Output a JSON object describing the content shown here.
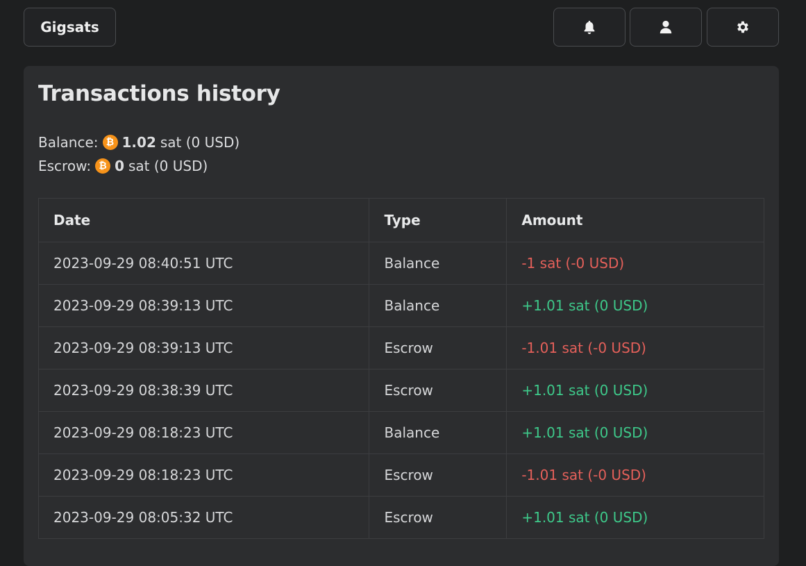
{
  "header": {
    "brand_label": "Gigsats",
    "icons": [
      "bell-icon",
      "user-icon",
      "gear-icon"
    ]
  },
  "page": {
    "title": "Transactions history",
    "balance": {
      "label": "Balance:",
      "value": "1.02",
      "unit": "sat (0 USD)"
    },
    "escrow": {
      "label": "Escrow:",
      "value": "0",
      "unit": "sat (0 USD)"
    },
    "btc_symbol": "₿"
  },
  "colors": {
    "negative": "#e5605a",
    "positive": "#3ec98a",
    "btc": "#f7931a"
  },
  "table": {
    "columns": [
      "Date",
      "Type",
      "Amount"
    ],
    "rows": [
      {
        "date": "2023-09-29 08:40:51 UTC",
        "type": "Balance",
        "amount": "-1 sat (-0 USD)",
        "sign": "neg"
      },
      {
        "date": "2023-09-29 08:39:13 UTC",
        "type": "Balance",
        "amount": "+1.01 sat (0 USD)",
        "sign": "pos"
      },
      {
        "date": "2023-09-29 08:39:13 UTC",
        "type": "Escrow",
        "amount": "-1.01 sat (-0 USD)",
        "sign": "neg"
      },
      {
        "date": "2023-09-29 08:38:39 UTC",
        "type": "Escrow",
        "amount": "+1.01 sat (0 USD)",
        "sign": "pos"
      },
      {
        "date": "2023-09-29 08:18:23 UTC",
        "type": "Balance",
        "amount": "+1.01 sat (0 USD)",
        "sign": "pos"
      },
      {
        "date": "2023-09-29 08:18:23 UTC",
        "type": "Escrow",
        "amount": "-1.01 sat (-0 USD)",
        "sign": "neg"
      },
      {
        "date": "2023-09-29 08:05:32 UTC",
        "type": "Escrow",
        "amount": "+1.01 sat (0 USD)",
        "sign": "pos"
      }
    ]
  }
}
